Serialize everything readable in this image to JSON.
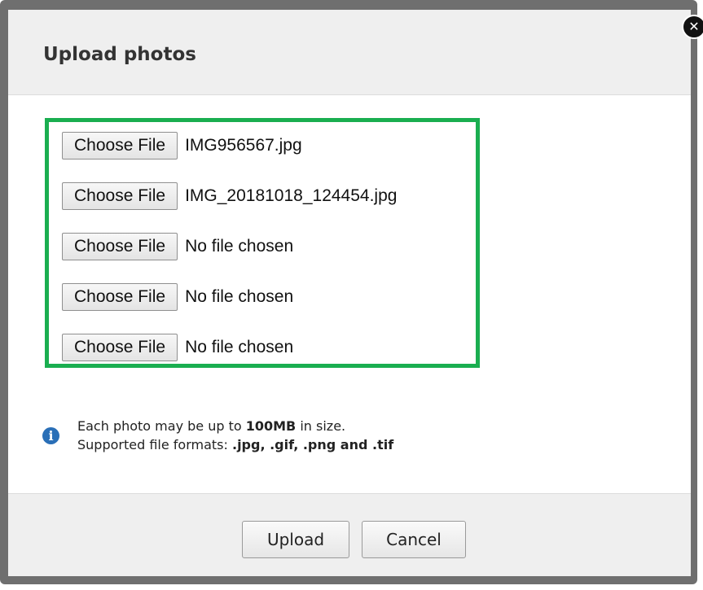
{
  "dialog": {
    "title": "Upload photos",
    "close_glyph": "✕"
  },
  "file_inputs": [
    {
      "button_label": "Choose File",
      "file_name": "IMG956567.jpg"
    },
    {
      "button_label": "Choose File",
      "file_name": "IMG_20181018_124454.jpg"
    },
    {
      "button_label": "Choose File",
      "file_name": "No file chosen"
    },
    {
      "button_label": "Choose File",
      "file_name": "No file chosen"
    },
    {
      "button_label": "Choose File",
      "file_name": "No file chosen"
    }
  ],
  "info": {
    "icon": "info-icon",
    "icon_glyph": "i",
    "line1_prefix": "Each photo may be up to ",
    "line1_bold": "100MB",
    "line1_suffix": " in size.",
    "line2_prefix": "Supported file formats: ",
    "line2_bold": ".jpg, .gif, .png and .tif"
  },
  "footer": {
    "upload_label": "Upload",
    "cancel_label": "Cancel"
  },
  "colors": {
    "highlight_border": "#1aae50",
    "info_icon": "#2a6fb7",
    "header_bg": "#efefef"
  }
}
